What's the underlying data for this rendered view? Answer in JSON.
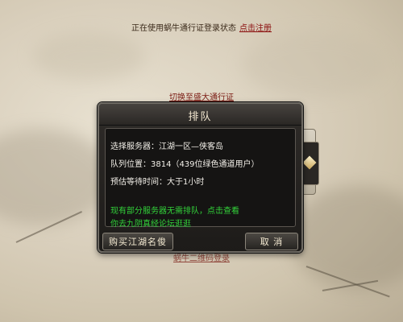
{
  "top_notice": {
    "text": "正在使用蜗牛通行证登录状态",
    "link": "点击注册"
  },
  "switch_link": "切换至盛大通行证",
  "qr_hint": "蜗牛二维码登录",
  "dialog": {
    "title": "排队",
    "server_line": "选择服务器：江湖一区—侠客岛",
    "queue_line": "队列位置：3814（439位绿色通道用户）",
    "wait_line": "预估等待时间：大于1小时",
    "notice_line1": "现有部分服务器无需排队，点击查看",
    "notice_line2": "九阴真经论坛逛逛",
    "notice_prefix2": "你去",
    "buy_button": "购买江湖名俊",
    "cancel_button": "取 消"
  },
  "colors": {
    "notice_green": "#32d23a",
    "link_red": "#8a0c0c",
    "dialog_bg": "#1d1b19"
  }
}
